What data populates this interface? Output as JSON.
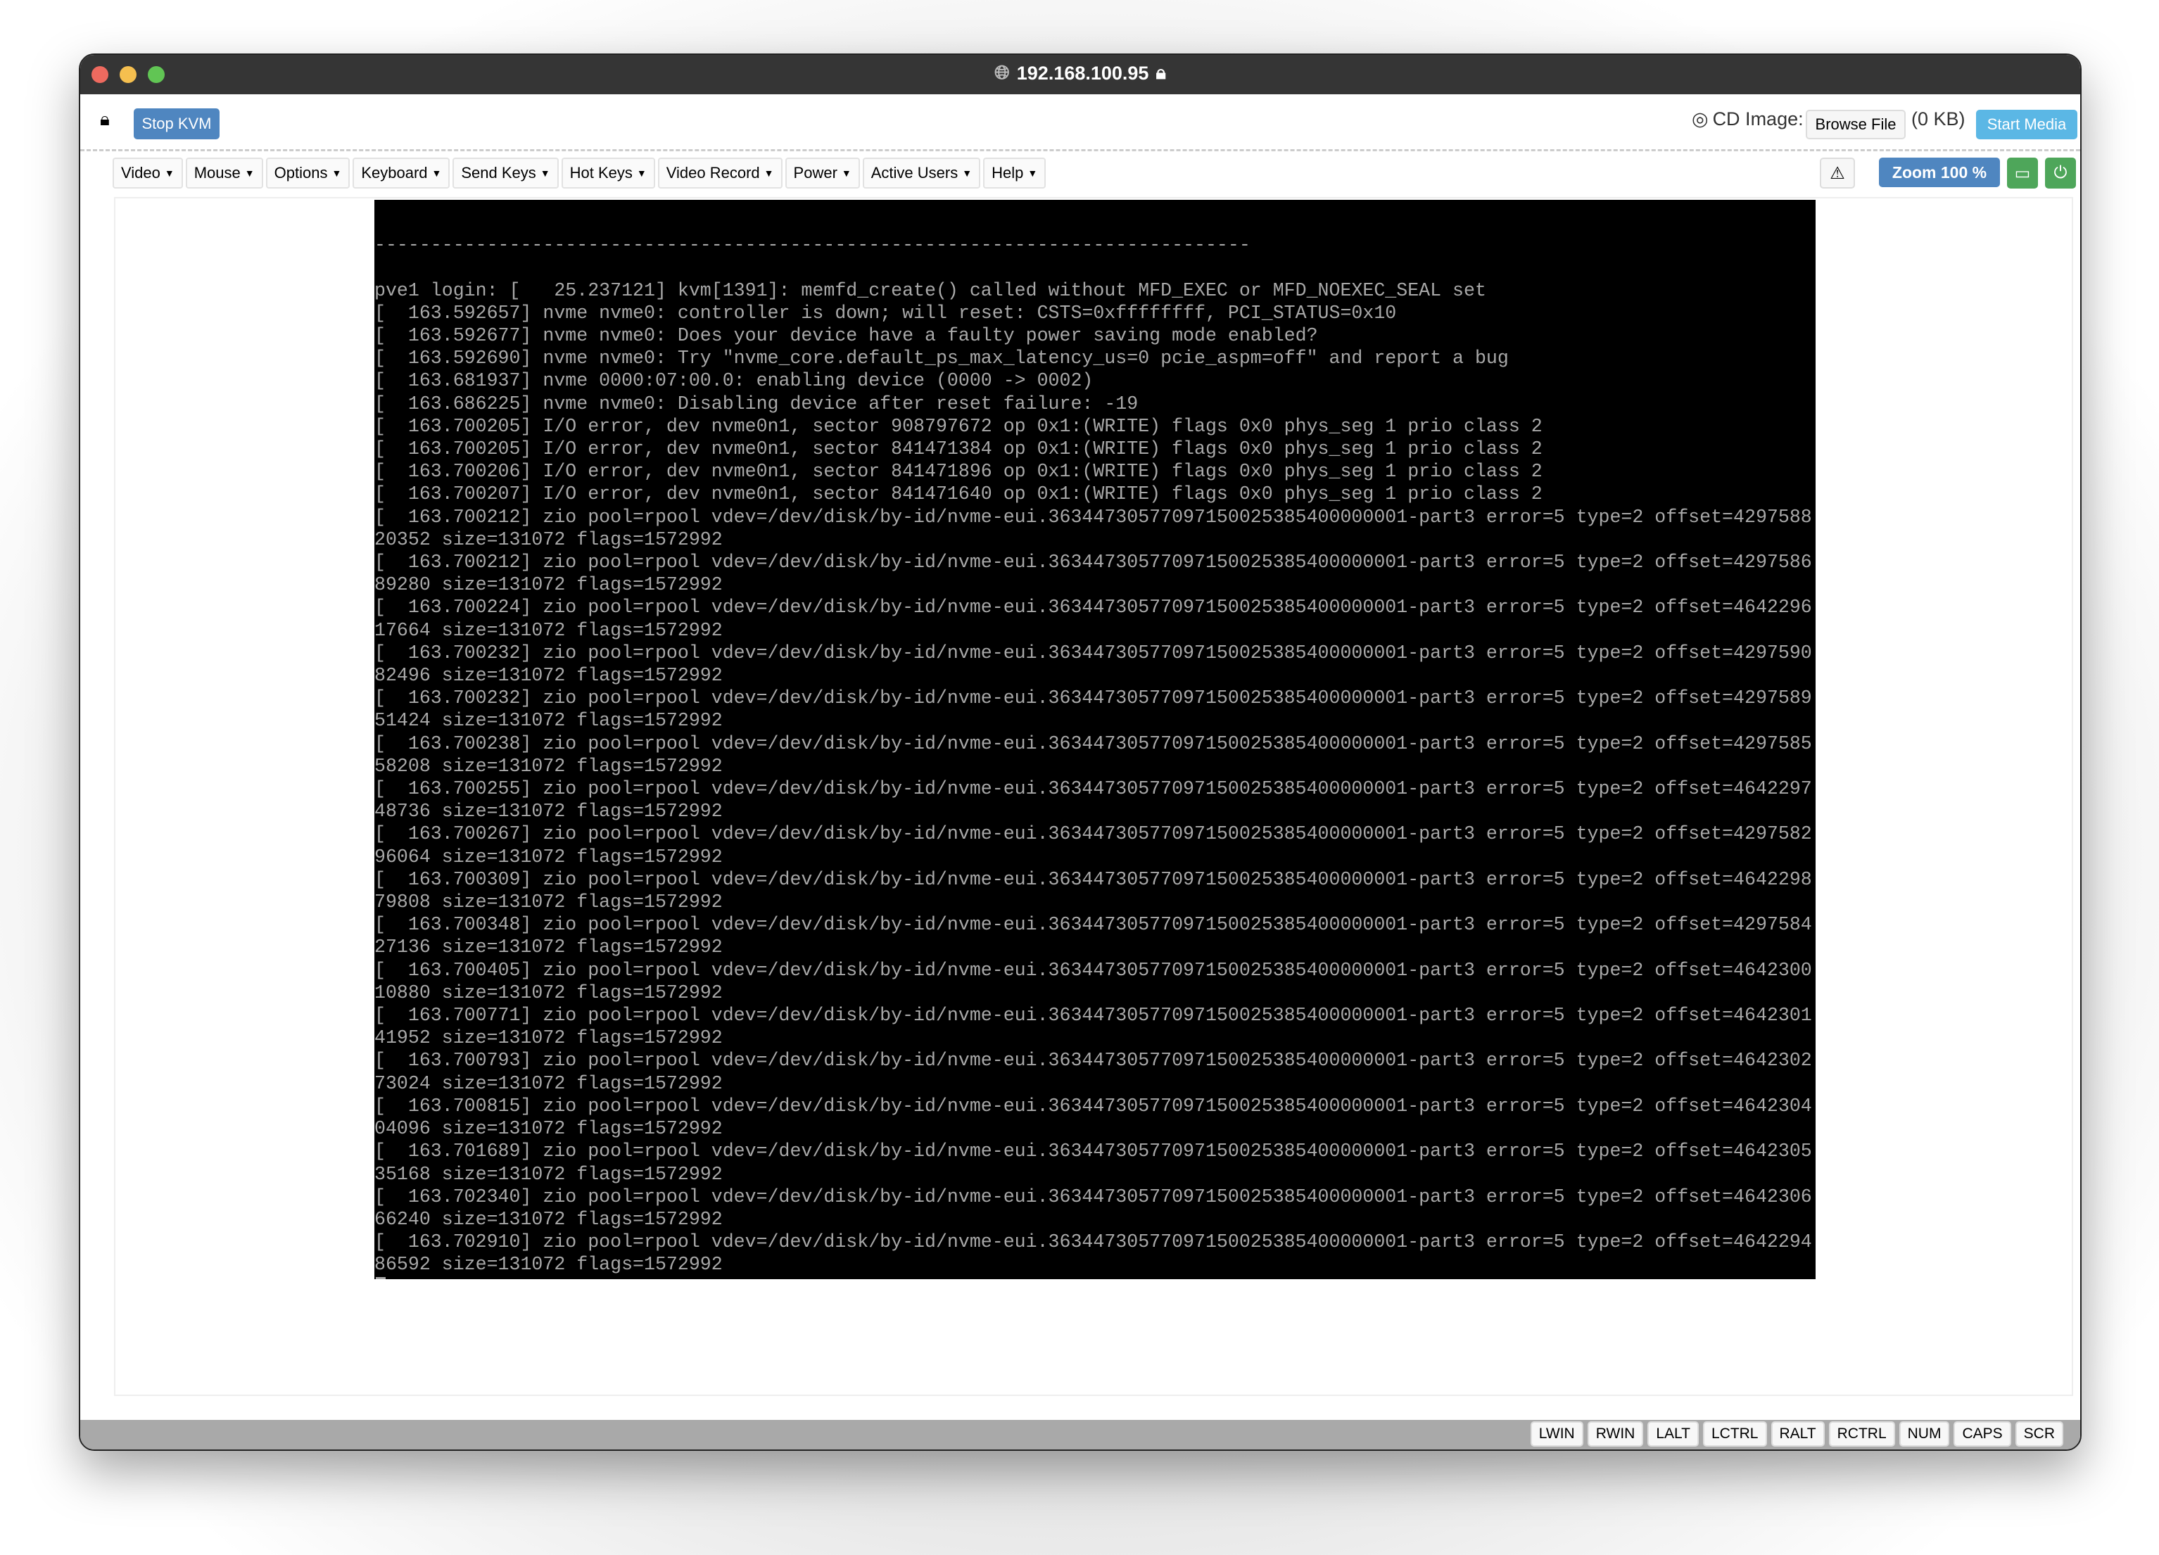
{
  "window": {
    "address": "192.168.100.95",
    "globe_icon": "globe-icon",
    "lock_icon": "lock-icon"
  },
  "toolbar": {
    "stop_kvm": "Stop KVM",
    "cd_image_label": "CD Image:",
    "browse_file": "Browse File",
    "file_size": "(0 KB)",
    "start_media": "Start Media",
    "zoom": "Zoom 100 %"
  },
  "menus": [
    "Video",
    "Mouse",
    "Options",
    "Keyboard",
    "Send Keys",
    "Hot Keys",
    "Video Record",
    "Power",
    "Active Users",
    "Help"
  ],
  "colors": {
    "primary": "#4f86c0",
    "info": "#5bb7e5",
    "success": "#4ea65a",
    "terminal_bg": "#000000",
    "terminal_fg": "#a8a8a8"
  },
  "terminal": {
    "lines": [
      "",
      "------------------------------------------------------------------------------",
      "",
      "pve1 login: [   25.237121] kvm[1391]: memfd_create() called without MFD_EXEC or MFD_NOEXEC_SEAL set",
      "[  163.592657] nvme nvme0: controller is down; will reset: CSTS=0xffffffff, PCI_STATUS=0x10",
      "[  163.592677] nvme nvme0: Does your device have a faulty power saving mode enabled?",
      "[  163.592690] nvme nvme0: Try \"nvme_core.default_ps_max_latency_us=0 pcie_aspm=off\" and report a bug",
      "[  163.681937] nvme 0000:07:00.0: enabling device (0000 -> 0002)",
      "[  163.686225] nvme nvme0: Disabling device after reset failure: -19",
      "[  163.700205] I/O error, dev nvme0n1, sector 908797672 op 0x1:(WRITE) flags 0x0 phys_seg 1 prio class 2",
      "[  163.700205] I/O error, dev nvme0n1, sector 841471384 op 0x1:(WRITE) flags 0x0 phys_seg 1 prio class 2",
      "[  163.700206] I/O error, dev nvme0n1, sector 841471896 op 0x1:(WRITE) flags 0x0 phys_seg 1 prio class 2",
      "[  163.700207] I/O error, dev nvme0n1, sector 841471640 op 0x1:(WRITE) flags 0x0 phys_seg 1 prio class 2",
      "[  163.700212] zio pool=rpool vdev=/dev/disk/by-id/nvme-eui.36344730577097150025385400000001-part3 error=5 type=2 offset=429758820352 size=131072 flags=1572992",
      "[  163.700212] zio pool=rpool vdev=/dev/disk/by-id/nvme-eui.36344730577097150025385400000001-part3 error=5 type=2 offset=429758689280 size=131072 flags=1572992",
      "[  163.700224] zio pool=rpool vdev=/dev/disk/by-id/nvme-eui.36344730577097150025385400000001-part3 error=5 type=2 offset=464229617664 size=131072 flags=1572992",
      "[  163.700232] zio pool=rpool vdev=/dev/disk/by-id/nvme-eui.36344730577097150025385400000001-part3 error=5 type=2 offset=429759082496 size=131072 flags=1572992",
      "[  163.700232] zio pool=rpool vdev=/dev/disk/by-id/nvme-eui.36344730577097150025385400000001-part3 error=5 type=2 offset=429758951424 size=131072 flags=1572992",
      "[  163.700238] zio pool=rpool vdev=/dev/disk/by-id/nvme-eui.36344730577097150025385400000001-part3 error=5 type=2 offset=429758558208 size=131072 flags=1572992",
      "[  163.700255] zio pool=rpool vdev=/dev/disk/by-id/nvme-eui.36344730577097150025385400000001-part3 error=5 type=2 offset=464229748736 size=131072 flags=1572992",
      "[  163.700267] zio pool=rpool vdev=/dev/disk/by-id/nvme-eui.36344730577097150025385400000001-part3 error=5 type=2 offset=429758296064 size=131072 flags=1572992",
      "[  163.700309] zio pool=rpool vdev=/dev/disk/by-id/nvme-eui.36344730577097150025385400000001-part3 error=5 type=2 offset=464229879808 size=131072 flags=1572992",
      "[  163.700348] zio pool=rpool vdev=/dev/disk/by-id/nvme-eui.36344730577097150025385400000001-part3 error=5 type=2 offset=429758427136 size=131072 flags=1572992",
      "[  163.700405] zio pool=rpool vdev=/dev/disk/by-id/nvme-eui.36344730577097150025385400000001-part3 error=5 type=2 offset=464230010880 size=131072 flags=1572992",
      "[  163.700771] zio pool=rpool vdev=/dev/disk/by-id/nvme-eui.36344730577097150025385400000001-part3 error=5 type=2 offset=464230141952 size=131072 flags=1572992",
      "[  163.700793] zio pool=rpool vdev=/dev/disk/by-id/nvme-eui.36344730577097150025385400000001-part3 error=5 type=2 offset=464230273024 size=131072 flags=1572992",
      "[  163.700815] zio pool=rpool vdev=/dev/disk/by-id/nvme-eui.36344730577097150025385400000001-part3 error=5 type=2 offset=464230404096 size=131072 flags=1572992",
      "[  163.701689] zio pool=rpool vdev=/dev/disk/by-id/nvme-eui.36344730577097150025385400000001-part3 error=5 type=2 offset=464230535168 size=131072 flags=1572992",
      "[  163.702340] zio pool=rpool vdev=/dev/disk/by-id/nvme-eui.36344730577097150025385400000001-part3 error=5 type=2 offset=464230666240 size=131072 flags=1572992",
      "[  163.702910] zio pool=rpool vdev=/dev/disk/by-id/nvme-eui.36344730577097150025385400000001-part3 error=5 type=2 offset=464229486592 size=131072 flags=1572992"
    ]
  },
  "status_keys": [
    "LWIN",
    "RWIN",
    "LALT",
    "LCTRL",
    "RALT",
    "RCTRL",
    "NUM",
    "CAPS",
    "SCR"
  ]
}
